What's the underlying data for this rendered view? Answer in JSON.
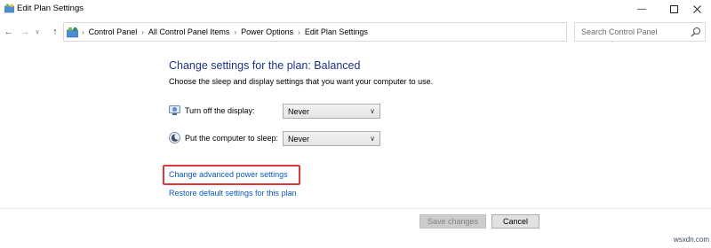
{
  "window": {
    "title": "Edit Plan Settings",
    "icon": "control-panel-icon",
    "controls": [
      "minimize-icon",
      "maximize-icon",
      "close-icon"
    ]
  },
  "nav": {
    "back_icon": "arrow-left-icon",
    "forward_icon": "arrow-right-icon",
    "recent_icon": "chevron-down-icon",
    "up_icon": "arrow-up-icon"
  },
  "address_bar": {
    "breadcrumbs": [
      "Control Panel",
      "All Control Panel Items",
      "Power Options",
      "Edit Plan Settings"
    ],
    "dropdown_icon": "chevron-down-icon",
    "refresh_icon": "refresh-icon"
  },
  "search": {
    "placeholder": "Search Control Panel",
    "icon": "search-icon"
  },
  "main": {
    "heading": "Change settings for the plan: Balanced",
    "subtext": "Choose the sleep and display settings that you want your computer to use.",
    "settings": [
      {
        "label": "Turn off the display:",
        "value": "Never",
        "icon": "display-icon"
      },
      {
        "label": "Put the computer to sleep:",
        "value": "Never",
        "icon": "sleep-moon-icon"
      }
    ],
    "links": {
      "advanced": "Change advanced power settings",
      "restore": "Restore default settings for this plan"
    }
  },
  "footer": {
    "save_label": "Save changes",
    "cancel_label": "Cancel"
  },
  "watermark": "wsxdn.com",
  "colors": {
    "heading": "#1e3287",
    "link": "#0b5ab5",
    "highlight": "#d83b3b"
  }
}
